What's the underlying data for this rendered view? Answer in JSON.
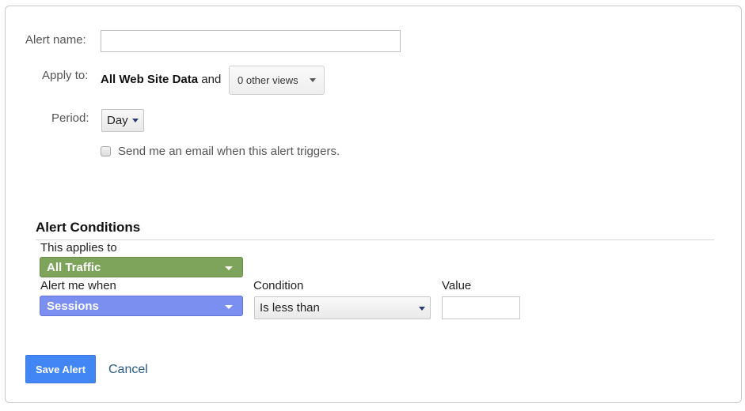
{
  "form": {
    "alert_name": {
      "label": "Alert name:",
      "value": "",
      "placeholder": ""
    },
    "apply_to": {
      "label": "Apply to:",
      "property": "All Web Site Data",
      "connector": "and",
      "views_dropdown": "0 other views"
    },
    "period": {
      "label": "Period:",
      "selected": "Day"
    },
    "email_checkbox": {
      "label": "Send me an email when this alert triggers.",
      "checked": false
    }
  },
  "conditions": {
    "title": "Alert Conditions",
    "applies_to_label": "This applies to",
    "applies_to_value": "All Traffic",
    "alert_when_label": "Alert me when",
    "alert_when_value": "Sessions",
    "condition_label": "Condition",
    "condition_value": "Is less than",
    "value_label": "Value",
    "value": "",
    "colors": {
      "applies_to": "#7ea35a",
      "alert_when": "#7b8ff0"
    }
  },
  "actions": {
    "save_label": "Save Alert",
    "cancel_label": "Cancel",
    "save_color": "#4285f4"
  }
}
